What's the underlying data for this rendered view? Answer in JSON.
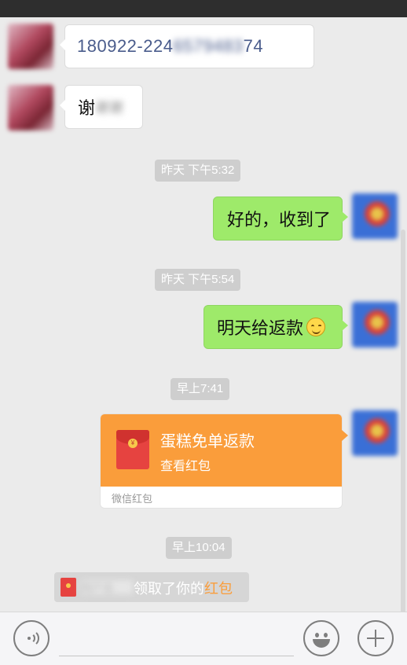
{
  "chat": {
    "messages": [
      {
        "side": "left",
        "type": "text",
        "text_visible": "180922-224",
        "text_blurred": "6579483",
        "text_tail": "74"
      },
      {
        "side": "left",
        "type": "text",
        "text_visible": "谢",
        "text_blurred": "谢谢"
      },
      {
        "type": "time",
        "text": "昨天 下午5:32"
      },
      {
        "side": "right",
        "type": "text",
        "text": "好的，收到了"
      },
      {
        "type": "time",
        "text": "昨天 下午5:54"
      },
      {
        "side": "right",
        "type": "text",
        "text": "明天给返款",
        "emoji": "smile-emoji"
      },
      {
        "type": "time",
        "text": "早上7:41"
      },
      {
        "side": "right",
        "type": "red_packet",
        "title": "蛋糕免单返款",
        "subtitle": "查看红包",
        "footer": "微信红包"
      },
      {
        "type": "time",
        "text": "早上10:04"
      }
    ],
    "system_notice": {
      "prefix_blurred": "用户名",
      "text": "领取了你的",
      "link": "红包"
    }
  },
  "input_bar": {
    "placeholder": "",
    "voice_icon": "voice-icon",
    "emoji_icon": "emoji-icon",
    "plus_icon": "plus-icon"
  },
  "colors": {
    "background": "#ebebeb",
    "bubble_green": "#9eea6a",
    "red_packet": "#fa9d3b",
    "link": "#fa9d3b"
  }
}
